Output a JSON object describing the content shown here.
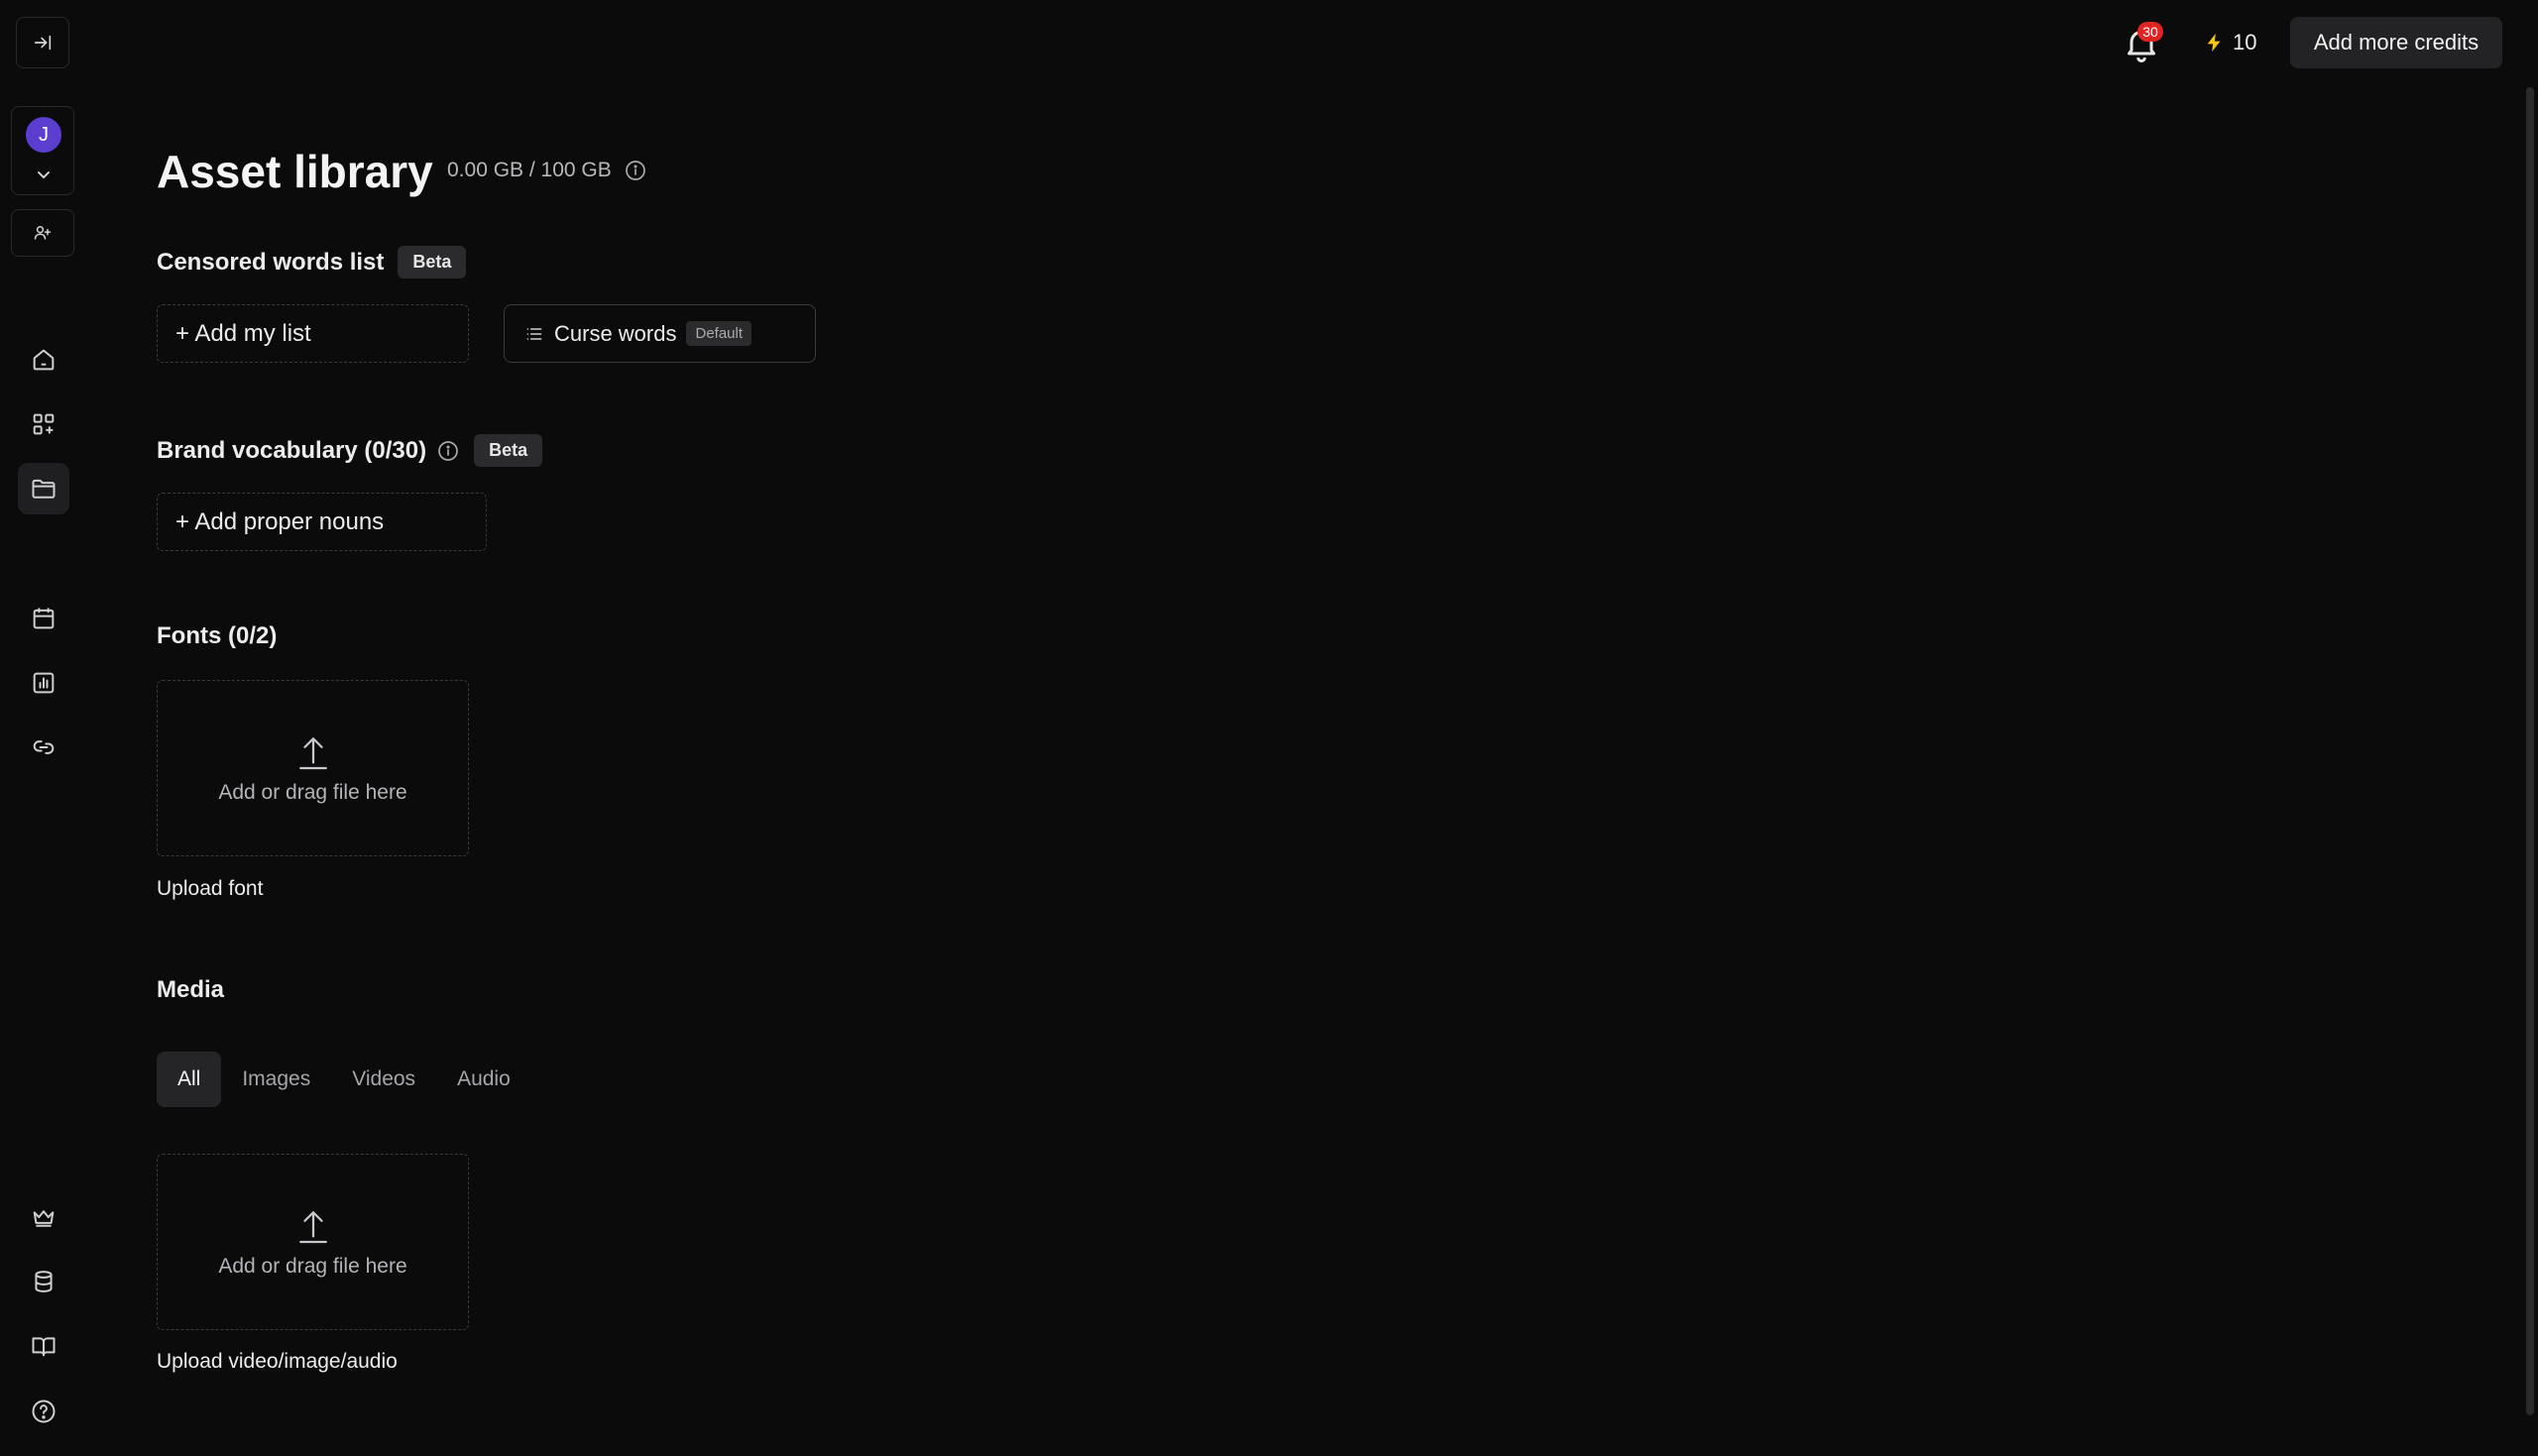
{
  "sidebar": {
    "collapse_icon": "collapse-right-icon",
    "user_initial": "J",
    "items": [
      {
        "name": "home",
        "icon": "home-icon"
      },
      {
        "name": "apps",
        "icon": "apps-icon"
      },
      {
        "name": "asset-library",
        "icon": "folder-icon",
        "active": true
      },
      {
        "name": "calendar",
        "icon": "calendar-icon"
      },
      {
        "name": "analytics",
        "icon": "chart-icon"
      },
      {
        "name": "links",
        "icon": "link-icon"
      }
    ],
    "bottom_items": [
      {
        "name": "crown",
        "icon": "crown-icon"
      },
      {
        "name": "database",
        "icon": "database-icon"
      },
      {
        "name": "docs",
        "icon": "book-icon"
      },
      {
        "name": "help",
        "icon": "help-icon"
      }
    ]
  },
  "topbar": {
    "notification_count": "30",
    "credits": "10",
    "add_credits_label": "Add more credits"
  },
  "page": {
    "title": "Asset library",
    "storage": "0.00 GB / 100 GB"
  },
  "censored": {
    "title": "Censored words list",
    "badge": "Beta",
    "add_label": "+ Add my list",
    "list_label": "Curse words",
    "list_tag": "Default"
  },
  "vocab": {
    "title": "Brand vocabulary (0/30)",
    "badge": "Beta",
    "add_label": "+ Add proper nouns"
  },
  "fonts": {
    "title": "Fonts (0/2)",
    "drop_label": "Add or drag file here",
    "caption": "Upload font"
  },
  "media": {
    "title": "Media",
    "tabs": [
      "All",
      "Images",
      "Videos",
      "Audio"
    ],
    "active_tab": "All",
    "drop_label": "Add or drag file here",
    "caption": "Upload video/image/audio"
  },
  "colors": {
    "background": "#0b0b0c",
    "avatar": "#5b3ecf",
    "badge_red": "#e02424",
    "bolt": "#f5c518"
  }
}
